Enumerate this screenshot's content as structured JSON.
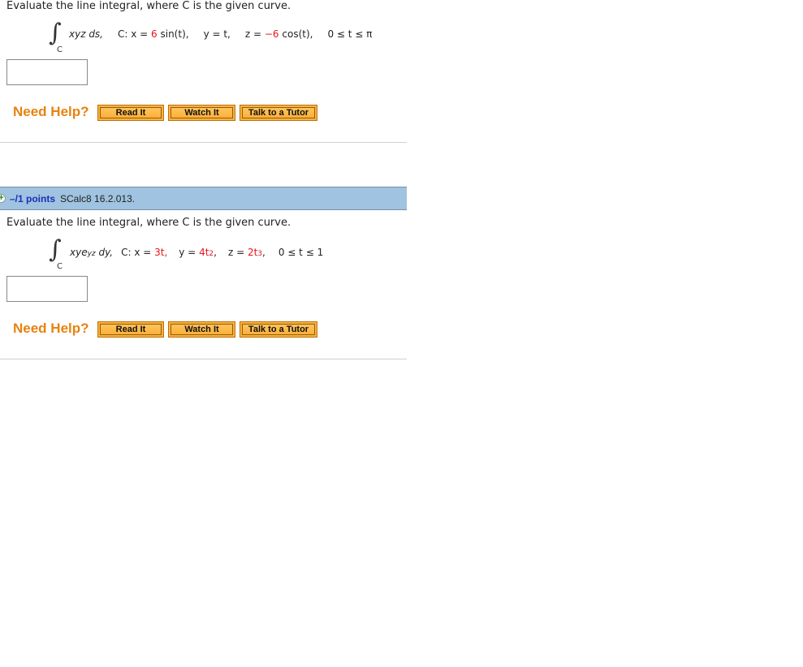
{
  "question1": {
    "prompt": "Evaluate the line integral, where C is the given curve.",
    "integral_symbol": "∫",
    "integral_subscript": "C",
    "integrand": "xyz ds,",
    "curve_label": "C: x = ",
    "x_coef": "6",
    "x_rest": " sin(t),",
    "y_eq": "y = t,",
    "z_label": "z = ",
    "z_coef": "−6",
    "z_rest": " cos(t),",
    "range": "0 ≤ t ≤ π",
    "answer_value": "",
    "need_help_label": "Need Help?",
    "buttons": [
      "Read It",
      "Watch It",
      "Talk to a Tutor"
    ]
  },
  "question2": {
    "header": {
      "expand_icon": "plus-circle-icon",
      "points": "–/1 points",
      "problem_id": "SCalc8 16.2.013."
    },
    "prompt": "Evaluate the line integral, where C is the given curve.",
    "integral_symbol": "∫",
    "integral_subscript": "C",
    "integrand_base": "xye",
    "integrand_exp": "yz",
    "integrand_tail": " dy,",
    "curve_label": "C: x = ",
    "x_coef": "3t,",
    "y_label": "y = ",
    "y_coef": "4t",
    "y_exp": "2",
    "z_label": "z = ",
    "z_coef": "2t",
    "z_exp": "3",
    "range": "0 ≤ t ≤ 1",
    "answer_value": "",
    "need_help_label": "Need Help?",
    "buttons": [
      "Read It",
      "Watch It",
      "Talk to a Tutor"
    ]
  },
  "colors": {
    "highlight_red": "#e8141b",
    "need_help_orange": "#e8820e",
    "button_orange": "#f7b33c",
    "header_blue": "#9fc3e0",
    "points_blue": "#1a2fb5"
  }
}
